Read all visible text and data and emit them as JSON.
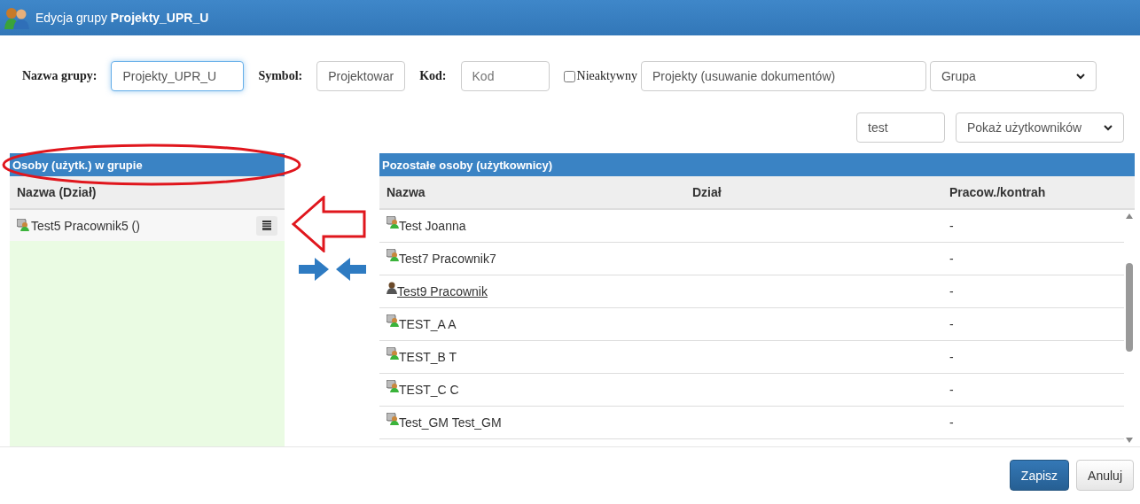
{
  "window": {
    "title_prefix": "Edycja grupy",
    "title_name": "Projekty_UPR_U"
  },
  "form": {
    "name_label": "Nazwa grupy:",
    "name_value": "Projekty_UPR_U",
    "symbol_label": "Symbol:",
    "symbol_value": "Projektowar",
    "code_label": "Kod:",
    "code_placeholder": "Kod",
    "inactive_label": "Nieaktywny",
    "inactive_checked": false,
    "description_value": "Projekty (usuwanie dokumentów)",
    "type_value": "Grupa"
  },
  "filter": {
    "search_value": "test",
    "show_value": "Pokaż użytkowników"
  },
  "members": {
    "title": "Osoby (użytk.) w grupie",
    "column": "Nazwa (Dział)",
    "rows": [
      {
        "name": "Test5 Pracownik5 ()"
      }
    ]
  },
  "others": {
    "title": "Pozostałe osoby (użytkownicy)",
    "columns": [
      "Nazwa",
      "Dział",
      "Pracow./kontrah"
    ],
    "rows": [
      {
        "kind": "user",
        "name": "Test Joanna",
        "link": false,
        "type": "-"
      },
      {
        "kind": "user",
        "name": "Test7 Pracownik7",
        "link": false,
        "type": "-"
      },
      {
        "kind": "worker",
        "name": "Test9 Pracownik",
        "link": true,
        "type": "-"
      },
      {
        "kind": "user",
        "name": "TEST_A A",
        "link": false,
        "type": "-"
      },
      {
        "kind": "user",
        "name": "TEST_B T",
        "link": false,
        "type": "-"
      },
      {
        "kind": "user",
        "name": "TEST_C C",
        "link": false,
        "type": "-"
      },
      {
        "kind": "user",
        "name": "Test_GM Test_GM",
        "link": false,
        "type": "-"
      }
    ]
  },
  "buttons": {
    "save": "Zapisz",
    "cancel": "Anuluj"
  }
}
